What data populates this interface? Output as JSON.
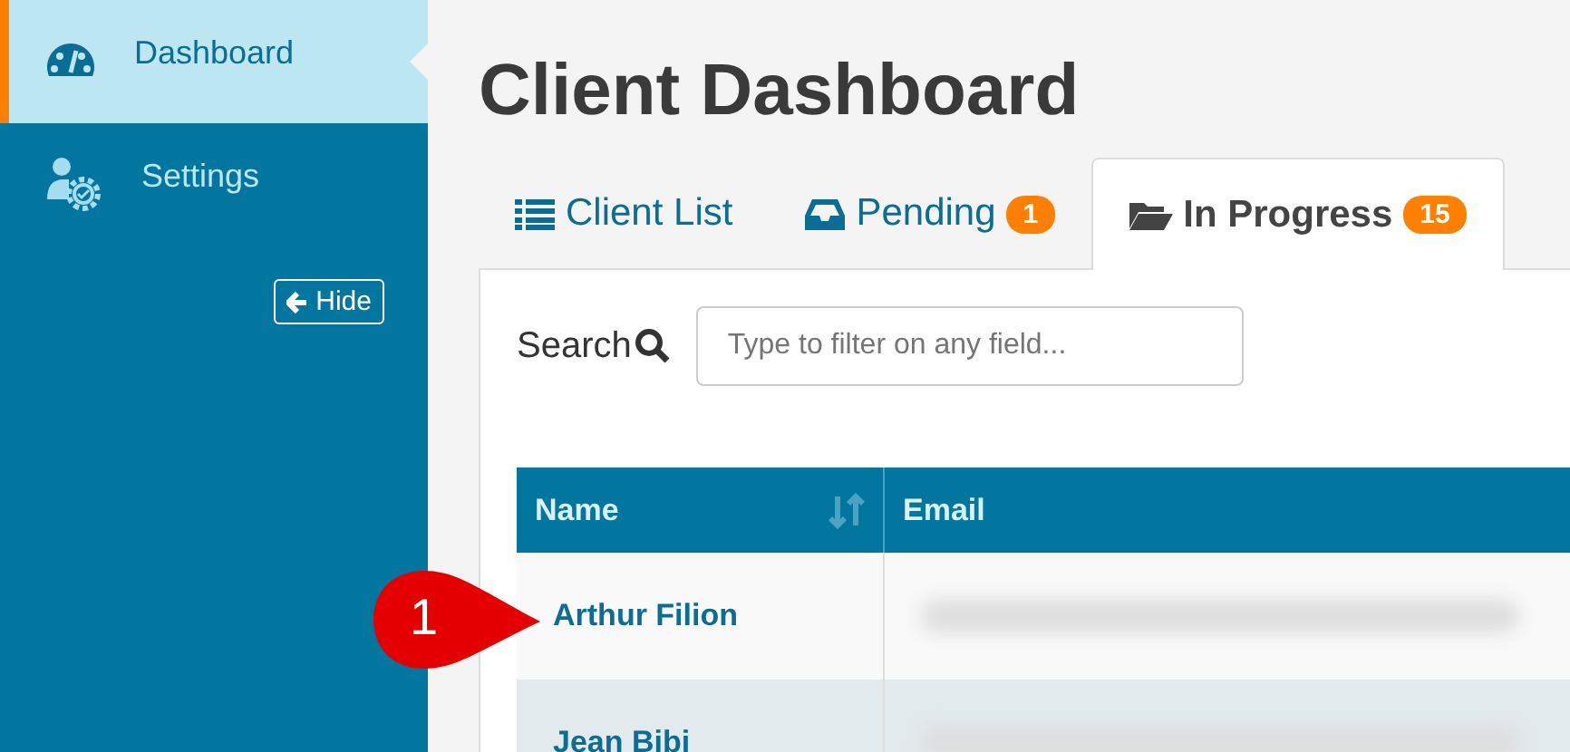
{
  "sidebar": {
    "items": [
      {
        "label": "Dashboard",
        "selected": true
      },
      {
        "label": "Settings",
        "selected": false
      }
    ],
    "hide_button": "Hide"
  },
  "title": "Client Dashboard",
  "tabs": [
    {
      "label": "Client List",
      "selected": false
    },
    {
      "label": "Pending",
      "badge": "1",
      "selected": false
    },
    {
      "label": "In Progress",
      "badge": "15",
      "selected": true
    }
  ],
  "search": {
    "label": "Search",
    "placeholder": "Type to filter on any field..."
  },
  "table": {
    "columns": [
      "Name",
      "Email"
    ],
    "rows": [
      {
        "name": "Arthur Filion"
      },
      {
        "name": "Jean Bibi"
      }
    ]
  },
  "callout": {
    "label": "1"
  }
}
